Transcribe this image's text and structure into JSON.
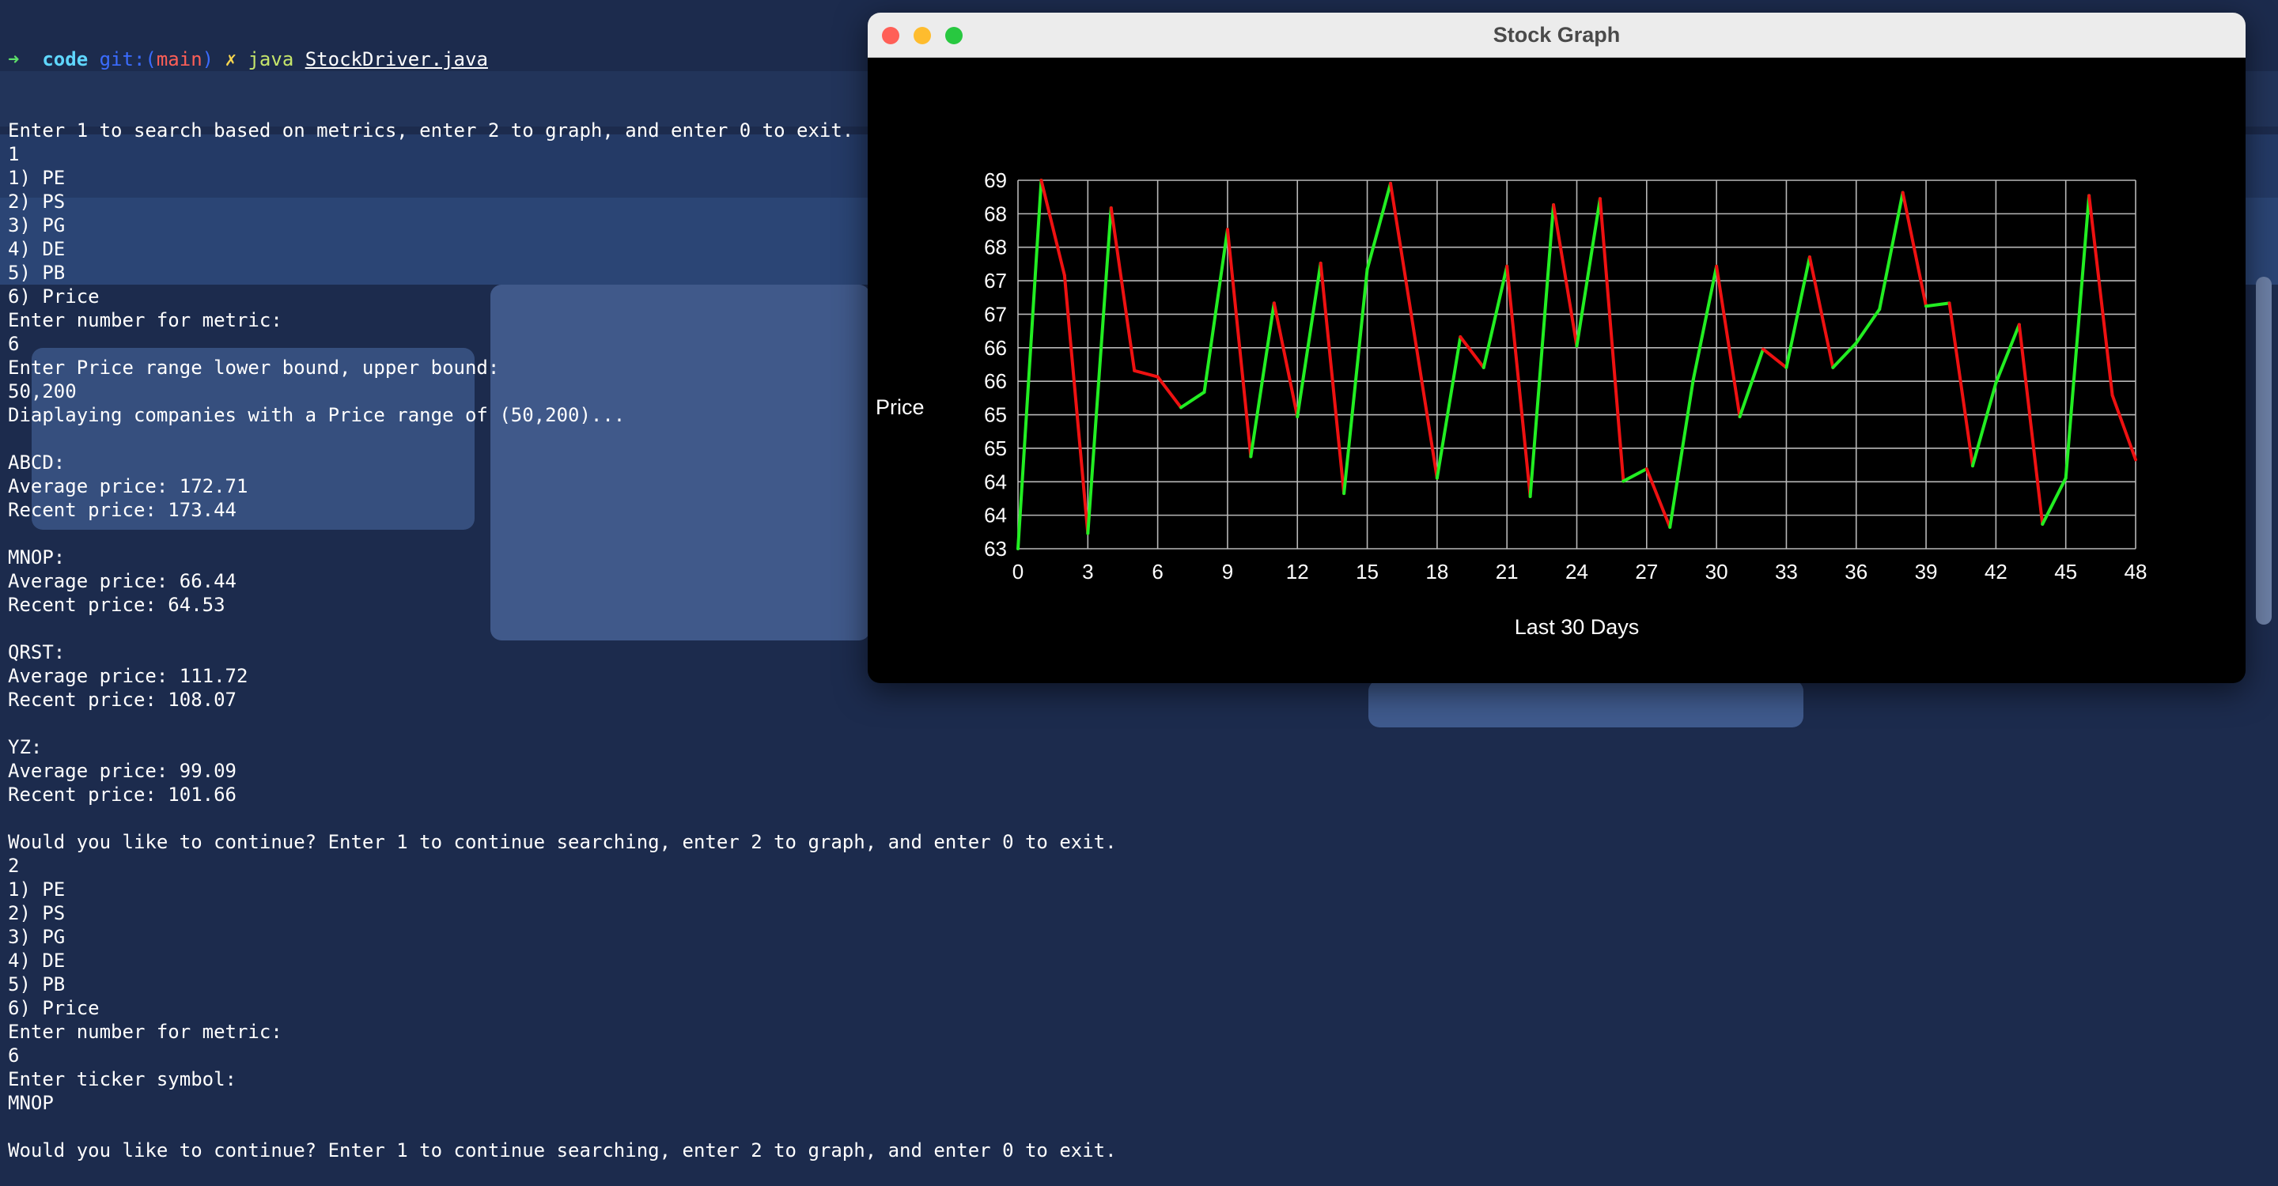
{
  "terminal": {
    "prompt": {
      "arrow": "➜",
      "dir": "code",
      "git": "git:(",
      "branch": "main",
      "git_close": ")",
      "dirty": "✗",
      "command": "java",
      "file": "StockDriver.java"
    },
    "lines": [
      "Enter 1 to search based on metrics, enter 2 to graph, and enter 0 to exit.",
      "1",
      "1) PE",
      "2) PS",
      "3) PG",
      "4) DE",
      "5) PB",
      "6) Price",
      "Enter number for metric:",
      "6",
      "Enter Price range lower bound, upper bound:",
      "50,200",
      "Diaplaying companies with a Price range of (50,200)...",
      "",
      "ABCD:",
      "Average price: 172.71",
      "Recent price: 173.44",
      "",
      "MNOP:",
      "Average price: 66.44",
      "Recent price: 64.53",
      "",
      "QRST:",
      "Average price: 111.72",
      "Recent price: 108.07",
      "",
      "YZ:",
      "Average price: 99.09",
      "Recent price: 101.66",
      "",
      "Would you like to continue? Enter 1 to continue searching, enter 2 to graph, and enter 0 to exit.",
      "2",
      "1) PE",
      "2) PS",
      "3) PG",
      "4) DE",
      "5) PB",
      "6) Price",
      "Enter number for metric:",
      "6",
      "Enter ticker symbol:",
      "MNOP",
      "",
      "Would you like to continue? Enter 1 to continue searching, enter 2 to graph, and enter 0 to exit."
    ]
  },
  "window": {
    "title": "Stock Graph",
    "controls": [
      "close-icon",
      "minimize-icon",
      "maximize-icon"
    ]
  },
  "colors": {
    "up": "#22ee22",
    "down": "#ee1111",
    "grid": "#b8b8b8",
    "axis_text": "#ffffff",
    "background": "#000000"
  },
  "chart_data": {
    "type": "line",
    "title": "",
    "xlabel": "Last 30 Days",
    "ylabel": "Price",
    "xlim": [
      0,
      48
    ],
    "ylim": [
      63,
      69
    ],
    "x_ticks": [
      "0",
      "3",
      "6",
      "9",
      "12",
      "15",
      "18",
      "21",
      "24",
      "27",
      "30",
      "33",
      "36",
      "39",
      "42",
      "45",
      "48"
    ],
    "y_ticks": [
      "63",
      "64",
      "64",
      "65",
      "65",
      "66",
      "66",
      "67",
      "67",
      "68",
      "68",
      "69"
    ],
    "grid": true,
    "coloring": "segment green when rising, red when falling",
    "x": [
      0,
      1,
      2,
      3,
      4,
      5,
      6,
      7,
      8,
      9,
      10,
      11,
      12,
      13,
      14,
      15,
      16,
      17,
      18,
      19,
      20,
      21,
      22,
      23,
      24,
      25,
      26,
      27,
      28,
      29,
      30,
      31,
      32,
      33,
      34,
      35,
      36,
      37,
      38,
      39,
      40,
      41,
      42,
      43,
      44,
      45,
      46,
      47,
      48
    ],
    "values": [
      63.0,
      69.0,
      67.45,
      63.25,
      68.55,
      65.9,
      65.8,
      65.3,
      65.55,
      68.2,
      64.5,
      67.0,
      65.15,
      67.65,
      63.9,
      67.55,
      68.95,
      66.55,
      64.15,
      66.45,
      65.95,
      67.6,
      63.85,
      68.6,
      66.3,
      68.7,
      64.1,
      64.3,
      63.35,
      65.75,
      67.6,
      65.15,
      66.25,
      65.95,
      67.75,
      65.95,
      66.35,
      66.9,
      68.8,
      66.95,
      67.0,
      64.35,
      65.7,
      66.65,
      63.4,
      64.15,
      68.75,
      65.5,
      64.45
    ]
  }
}
